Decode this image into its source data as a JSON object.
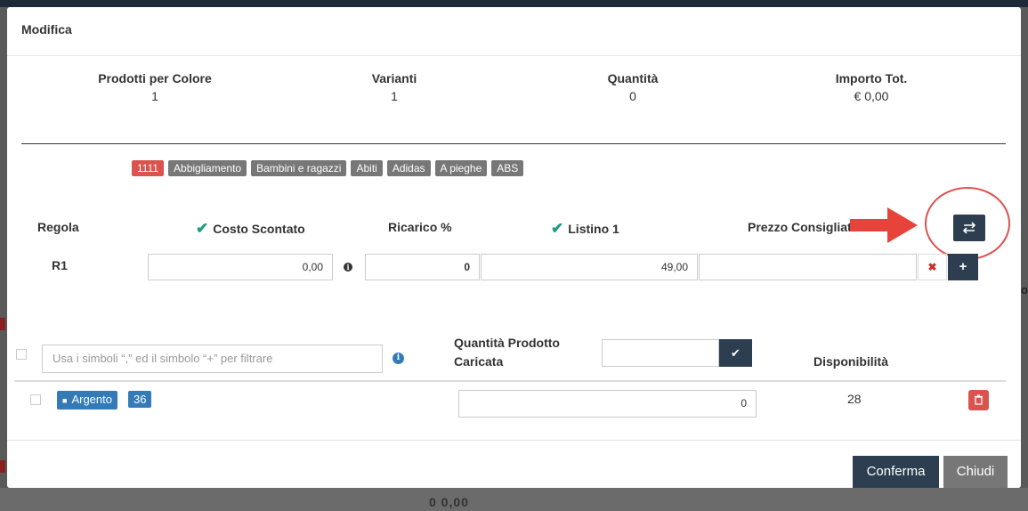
{
  "modal": {
    "title": "Modifica",
    "stats": [
      {
        "label": "Prodotti per Colore",
        "value": "1"
      },
      {
        "label": "Varianti",
        "value": "1"
      },
      {
        "label": "Quantità",
        "value": "0"
      },
      {
        "label": "Importo Tot.",
        "value": "€ 0,00"
      }
    ],
    "tags": [
      "1111",
      "Abbigliamento",
      "Bambini e ragazzi",
      "Abiti",
      "Adidas",
      "A pieghe",
      "ABS"
    ],
    "columns": {
      "regola": "Regola",
      "costo": "Costo Scontato",
      "ricarico": "Ricarico %",
      "listino": "Listino 1",
      "prezzo": "Prezzo Consigliato"
    },
    "rule_row": {
      "name": "R1",
      "costo": "0,00",
      "ricarico": "0",
      "listino": "49,00",
      "prezzo": ""
    },
    "filter": {
      "placeholder": "Usa i simboli “,” ed il simbolo “+” per filtrare",
      "quantity_label_line1": "Quantità Prodotto",
      "quantity_label_line2": "Caricata",
      "availability_label": "Disponibilità"
    },
    "variant_row": {
      "color": "Argento",
      "size": "36",
      "quantity": "0",
      "availability": "28"
    },
    "footer": {
      "confirm": "Conferma",
      "close": "Chiudi"
    }
  },
  "background": {
    "bottom_text": "0 0,00",
    "side_text": "o"
  },
  "colors": {
    "primary": "#2c3e50",
    "danger": "#d9534f",
    "label_blue": "#337ab7",
    "check_green": "#1a9e86",
    "tag_grey": "#777777"
  },
  "icons": [
    "check-icon",
    "info-icon",
    "swap-arrows-icon",
    "remove-icon",
    "plus-icon",
    "checkmark-icon",
    "trash-icon",
    "annotation-arrow-icon"
  ]
}
